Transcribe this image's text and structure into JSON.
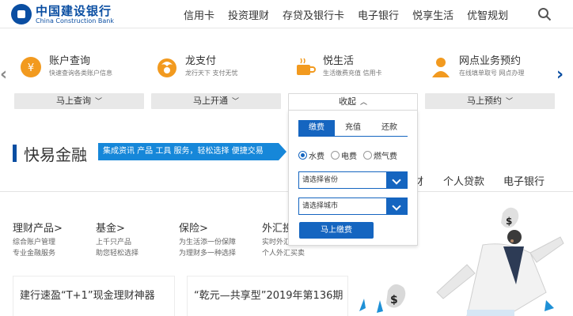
{
  "brand": {
    "name_cn": "中国建设银行",
    "name_en": "China Construction Bank"
  },
  "nav": {
    "items": [
      {
        "label": "信用卡"
      },
      {
        "label": "投资理财"
      },
      {
        "label": "存贷及银行卡"
      },
      {
        "label": "电子银行"
      },
      {
        "label": "悦享生活"
      },
      {
        "label": "优智规划"
      }
    ]
  },
  "services": [
    {
      "title": "账户查询",
      "desc": "快速查询各类账户信息",
      "button": "马上查询",
      "icon": "coin-icon"
    },
    {
      "title": "龙支付",
      "desc": "龙行天下 支付无忧",
      "button": "马上开通",
      "icon": "dragon-pay-icon"
    },
    {
      "title": "悦生活",
      "desc": "生活缴费充值 信用卡",
      "button": "收起",
      "icon": "coffee-cup-icon"
    },
    {
      "title": "网点业务预约",
      "desc": "在线填单取号 网点办理",
      "button": "马上预约",
      "icon": "person-icon"
    }
  ],
  "payment_panel": {
    "tabs": [
      "缴费",
      "充值",
      "还款"
    ],
    "active_tab": "缴费",
    "options": [
      "水费",
      "电费",
      "燃气费"
    ],
    "selected_option": "水费",
    "province_placeholder": "请选择省份",
    "city_placeholder": "请选择城市",
    "submit_label": "马上缴费"
  },
  "kyjr": {
    "title": "快易金融",
    "banner": "集成资讯 产品 工具 服务，轻松选择 便捷交易"
  },
  "right_tabs": [
    "财",
    "个人贷款",
    "电子银行"
  ],
  "categories": [
    {
      "title": "理财产品>",
      "lines": [
        "综合账户管理",
        "专业金融服务"
      ]
    },
    {
      "title": "基金>",
      "lines": [
        "上千只产品",
        "助您轻松选择"
      ]
    },
    {
      "title": "保险>",
      "lines": [
        "为生活添一份保障",
        "为理财多一种选择"
      ]
    },
    {
      "title": "外汇投",
      "lines": [
        "实时外汇",
        "个人外汇买卖"
      ]
    }
  ],
  "cards": [
    {
      "title": "建行速盈“T+1”现金理财神器"
    },
    {
      "title": "“乾元—共享型”2019年第136期"
    }
  ],
  "colors": {
    "brand_blue": "#0a4ea2",
    "accent_blue": "#1565c0",
    "banner_blue": "#1687d9"
  }
}
